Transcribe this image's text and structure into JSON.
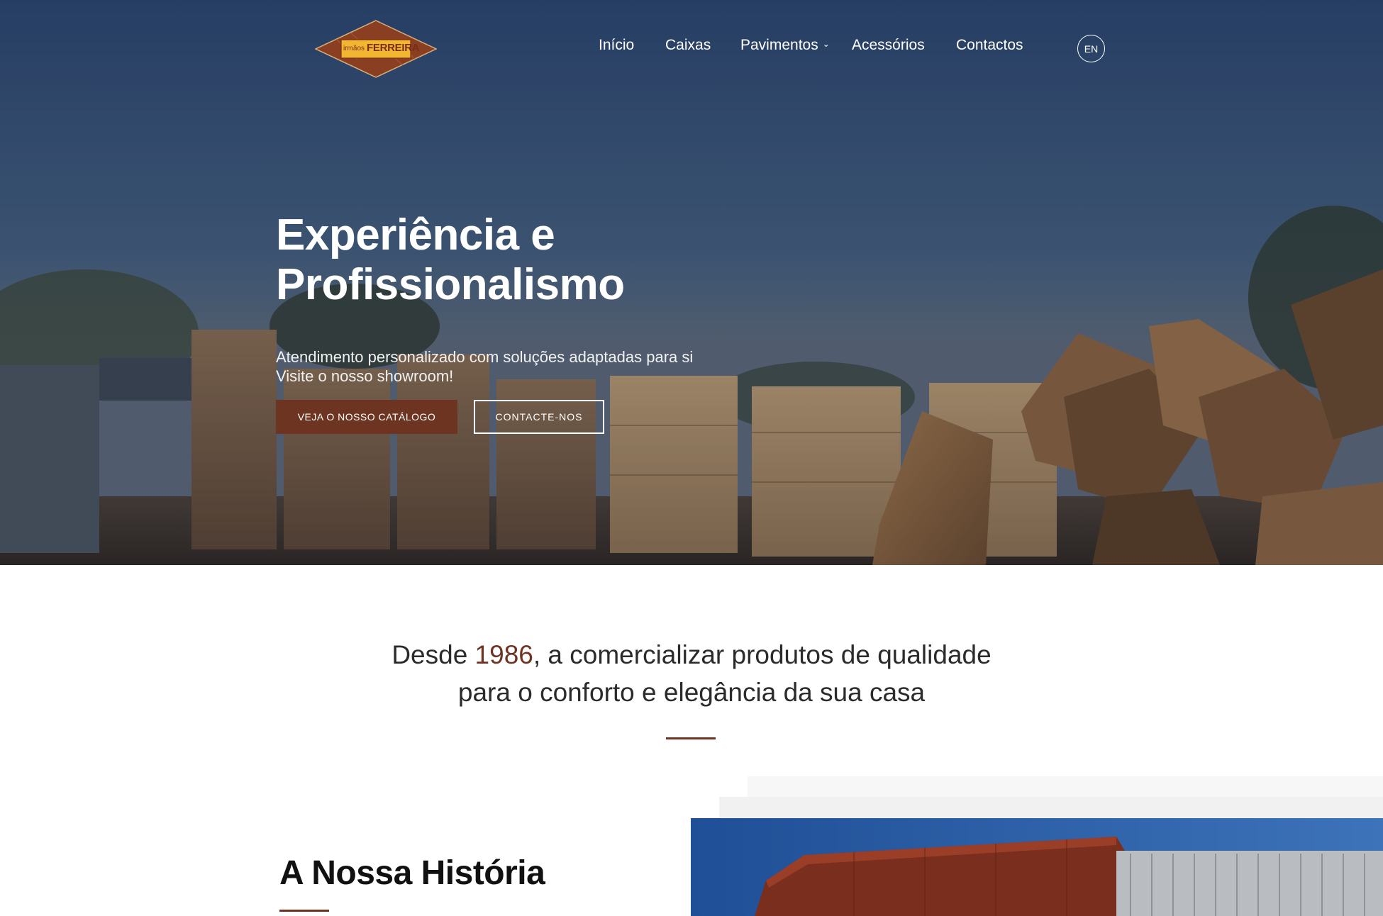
{
  "logo": {
    "text_small": "irmãos",
    "text_big": "FERREIRA",
    "colors": {
      "diamond": "#8a3f23",
      "plate": "#f2b631",
      "text": "#7a2d18"
    }
  },
  "nav": {
    "items": [
      {
        "label": "Início"
      },
      {
        "label": "Caixas"
      },
      {
        "label": "Pavimentos",
        "has_dropdown": true
      },
      {
        "label": "Acessórios"
      },
      {
        "label": "Contactos"
      }
    ],
    "language": "EN"
  },
  "hero": {
    "title_line1": "Experiência e",
    "title_line2": "Profissionalismo",
    "subtitle_line1": "Atendimento personalizado com soluções adaptadas para si",
    "subtitle_line2": "Visite o nosso showroom!",
    "primary_button": "VEJA O NOSSO CATÁLOGO",
    "secondary_button": "CONTACTE-NOS"
  },
  "intro": {
    "prefix": "Desde ",
    "year": "1986",
    "line1_rest": ", a comercializar produtos de qualidade",
    "line2": "para o conforto e elegância da sua casa"
  },
  "history": {
    "title": "A Nossa História"
  },
  "colors": {
    "accent": "#6e3422",
    "hero_sky": "#2f4a72",
    "text": "#2b2b2b"
  }
}
